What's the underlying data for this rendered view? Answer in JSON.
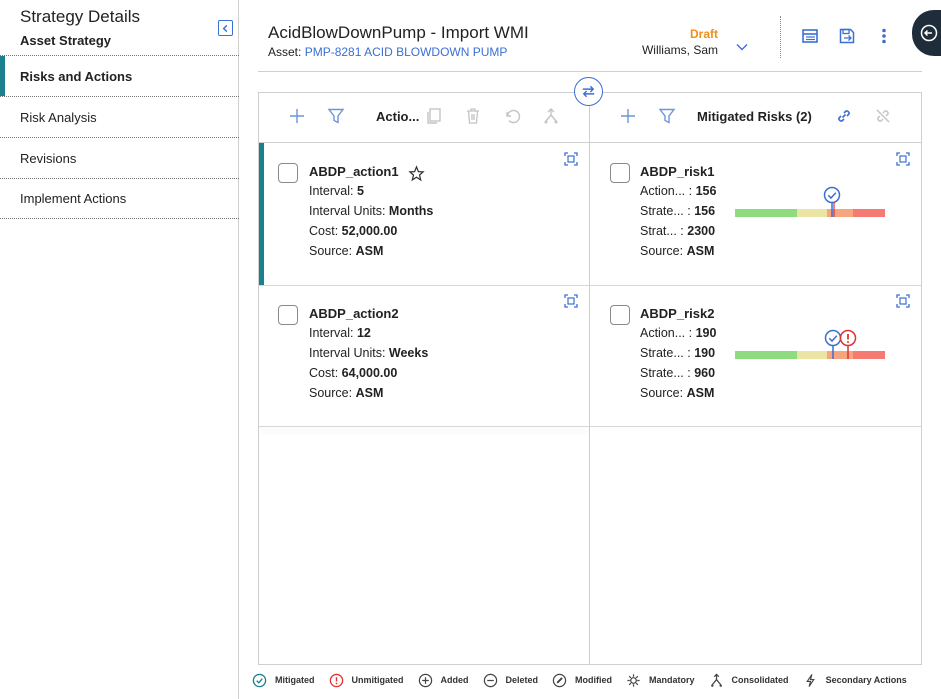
{
  "sidebar": {
    "title": "Strategy Details",
    "subtitle": "Asset Strategy",
    "items": [
      {
        "label": "Risks and Actions",
        "active": true
      },
      {
        "label": "Risk Analysis"
      },
      {
        "label": "Revisions"
      },
      {
        "label": "Implement Actions"
      }
    ]
  },
  "header": {
    "title": "AcidBlowDownPump - Import WMI",
    "asset_prefix": "Asset:",
    "asset_link": "PMP-8281 ACID BLOWDOWN PUMP",
    "state": "Draft",
    "user": "Williams, Sam"
  },
  "actions_panel": {
    "title": "Actio...",
    "cards": [
      {
        "name": "ABDP_action1",
        "interval_label": "Interval:",
        "interval": "5",
        "units_label": "Interval Units:",
        "units": "Months",
        "cost_label": "Cost:",
        "cost": "52,000.00",
        "source_label": "Source:",
        "source": "ASM"
      },
      {
        "name": "ABDP_action2",
        "interval_label": "Interval:",
        "interval": "12",
        "units_label": "Interval Units:",
        "units": "Weeks",
        "cost_label": "Cost:",
        "cost": "64,000.00",
        "source_label": "Source:",
        "source": "ASM"
      }
    ]
  },
  "risks_panel": {
    "title": "Mitigated Risks (2)",
    "cards": [
      {
        "name": "ABDP_risk1",
        "r1_label": "Action... :",
        "r1": "156",
        "r2_label": "Strate... :",
        "r2": "156",
        "r3_label": "Strat... :",
        "r3": "2300",
        "source_label": "Source:",
        "source": "ASM",
        "markers": [
          "mitigated"
        ]
      },
      {
        "name": "ABDP_risk2",
        "r1_label": "Action... :",
        "r1": "190",
        "r2_label": "Strate... :",
        "r2": "190",
        "r3_label": "Strate... :",
        "r3": "960",
        "source_label": "Source:",
        "source": "ASM",
        "markers": [
          "mitigated",
          "unmitigated"
        ]
      }
    ]
  },
  "legend": [
    {
      "label": "Mitigated",
      "icon": "check-circle-icon"
    },
    {
      "label": "Unmitigated",
      "icon": "exclamation-circle-icon"
    },
    {
      "label": "Added",
      "icon": "plus-circle-icon"
    },
    {
      "label": "Deleted",
      "icon": "minus-circle-icon"
    },
    {
      "label": "Modified",
      "icon": "pencil-circle-icon"
    },
    {
      "label": "Mandatory",
      "icon": "gear-icon"
    },
    {
      "label": "Consolidated",
      "icon": "merge-icon"
    },
    {
      "label": "Secondary Actions",
      "icon": "lightning-icon"
    }
  ],
  "colors": {
    "accent": "#1b7f8e",
    "link": "#3b6fd4",
    "draft": "#f28c1a",
    "risk_low": "#8fdc7f",
    "risk_mid": "#ece4a5",
    "risk_high": "#f6a57f",
    "risk_max": "#f57b72"
  }
}
